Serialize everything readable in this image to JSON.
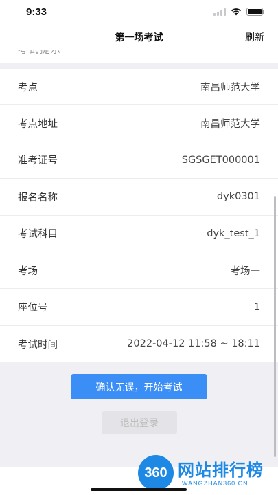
{
  "status": {
    "time": "9:33"
  },
  "nav": {
    "title": "第一场考试",
    "refresh": "刷新"
  },
  "peek": "考试提示",
  "info": [
    {
      "label": "考点",
      "value": "南昌师范大学"
    },
    {
      "label": "考点地址",
      "value": "南昌师范大学"
    },
    {
      "label": "准考证号",
      "value": "SGSGET000001"
    },
    {
      "label": "报名名称",
      "value": "dyk0301"
    },
    {
      "label": "考试科目",
      "value": "dyk_test_1"
    },
    {
      "label": "考场",
      "value": "考场一"
    },
    {
      "label": "座位号",
      "value": "1"
    },
    {
      "label": "考试时间",
      "value": "2022-04-12 11:58 ~ 18:11"
    }
  ],
  "actions": {
    "confirm": "确认无误，开始考试",
    "logout": "退出登录"
  },
  "watermark": {
    "logo_text": "360",
    "title": "网站排行榜",
    "subtitle": "WANGZHAN360.CN"
  },
  "colors": {
    "primary": "#3a8ef5",
    "watermark": "#1e88e5"
  }
}
